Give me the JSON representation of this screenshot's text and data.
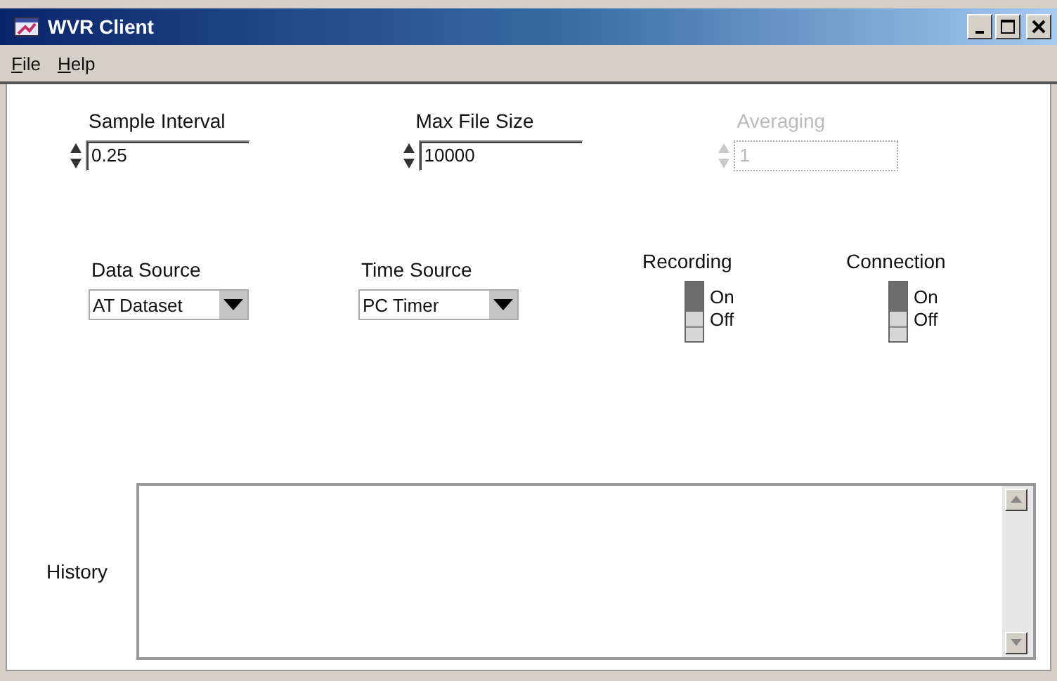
{
  "window": {
    "title": "WVR Client"
  },
  "menu": [
    {
      "label": "File"
    },
    {
      "label": "Help"
    }
  ],
  "numeric_fields": [
    {
      "label": "Sample Interval",
      "value": "0.25",
      "disabled": false
    },
    {
      "label": "Max File Size",
      "value": "10000",
      "disabled": false
    },
    {
      "label": "Averaging",
      "value": "1",
      "disabled": true
    }
  ],
  "dropdowns": [
    {
      "label": "Data Source",
      "value": "AT Dataset"
    },
    {
      "label": "Time Source",
      "value": "PC Timer"
    }
  ],
  "switches": [
    {
      "label": "Recording",
      "on_label": "On",
      "off_label": "Off",
      "on": false
    },
    {
      "label": "Connection",
      "on_label": "On",
      "off_label": "Off",
      "on": false
    }
  ],
  "history": {
    "label": "History"
  }
}
